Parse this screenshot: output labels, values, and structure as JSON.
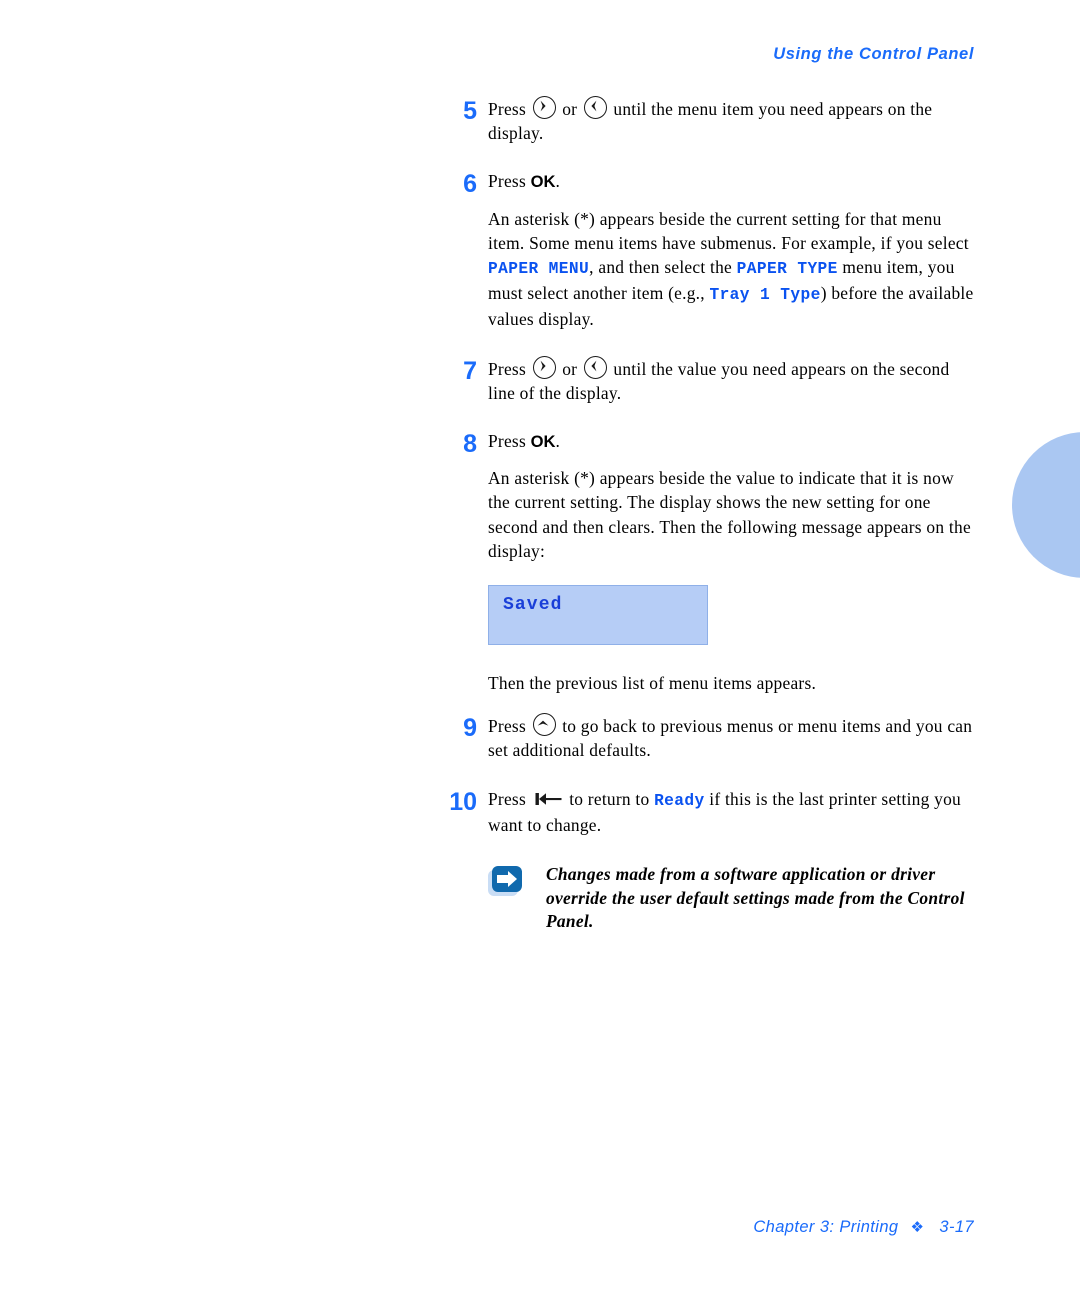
{
  "header": {
    "running_head": "Using the Control Panel",
    "color": "#1a6bfa"
  },
  "steps": [
    {
      "number": "5",
      "text_before": "Press",
      "icon_1": "circle-right-arrow-button-icon",
      "conjunction": "or",
      "icon_2": "circle-left-arrow-button-icon",
      "text_after": "until the menu item you need appears on the display."
    },
    {
      "number": "6",
      "text_before": "Press",
      "bold_label": "OK",
      "text_after": ".",
      "body_segments": {
        "s1": "An asterisk (*) appears beside the current setting for that menu item. Some menu items have submenus. For example, if you select ",
        "code1": "PAPER MENU",
        "s2": ", and then select the ",
        "code2": "PAPER TYPE",
        "s3": " menu item, you must select another item (e.g., ",
        "code3": "Tray 1 Type",
        "s4": ") before the available values display."
      }
    },
    {
      "number": "7",
      "text_before": "Press",
      "icon_1": "circle-right-arrow-button-icon",
      "conjunction": "or",
      "icon_2": "circle-left-arrow-button-icon",
      "text_after": "until the value you need appears on the second line of the display."
    },
    {
      "number": "8",
      "text_before": "Press",
      "bold_label": "OK",
      "text_after": ".",
      "body": "An asterisk (*) appears beside the value to indicate that it is now the current setting. The display shows the new setting for one second and then clears. Then the following message appears on the display:"
    },
    {
      "number": "9",
      "text_before": "Press",
      "icon_1": "circle-up-arrow-button-icon",
      "text_after": "to go back to previous menus or menu items and you can set additional defaults."
    },
    {
      "number": "10",
      "text_before": "Press",
      "icon_1": "return-arrow-button-icon",
      "text_mid": "to return to ",
      "code1": "Ready",
      "text_after": " if this is the last printer setting you want to change."
    }
  ],
  "lcd_display": {
    "message": "Saved",
    "fill_color": "#b6cdf6",
    "border_color": "#8fb0e8",
    "text_color": "#1a3fd8"
  },
  "after_lcd_text": "Then the previous list of menu items appears.",
  "note": {
    "icon": "note-arrow-icon",
    "icon_color": "#1069ad",
    "text": "Changes made from a software application or driver override the user default settings made from the Control Panel."
  },
  "footer": {
    "chapter": "Chapter 3: Printing",
    "separator": "❖",
    "page_number": "3-17",
    "color": "#1a6bfa"
  },
  "thumb_tab": {
    "name": "chapter-thumb-tab",
    "color": "#aac7f2"
  }
}
